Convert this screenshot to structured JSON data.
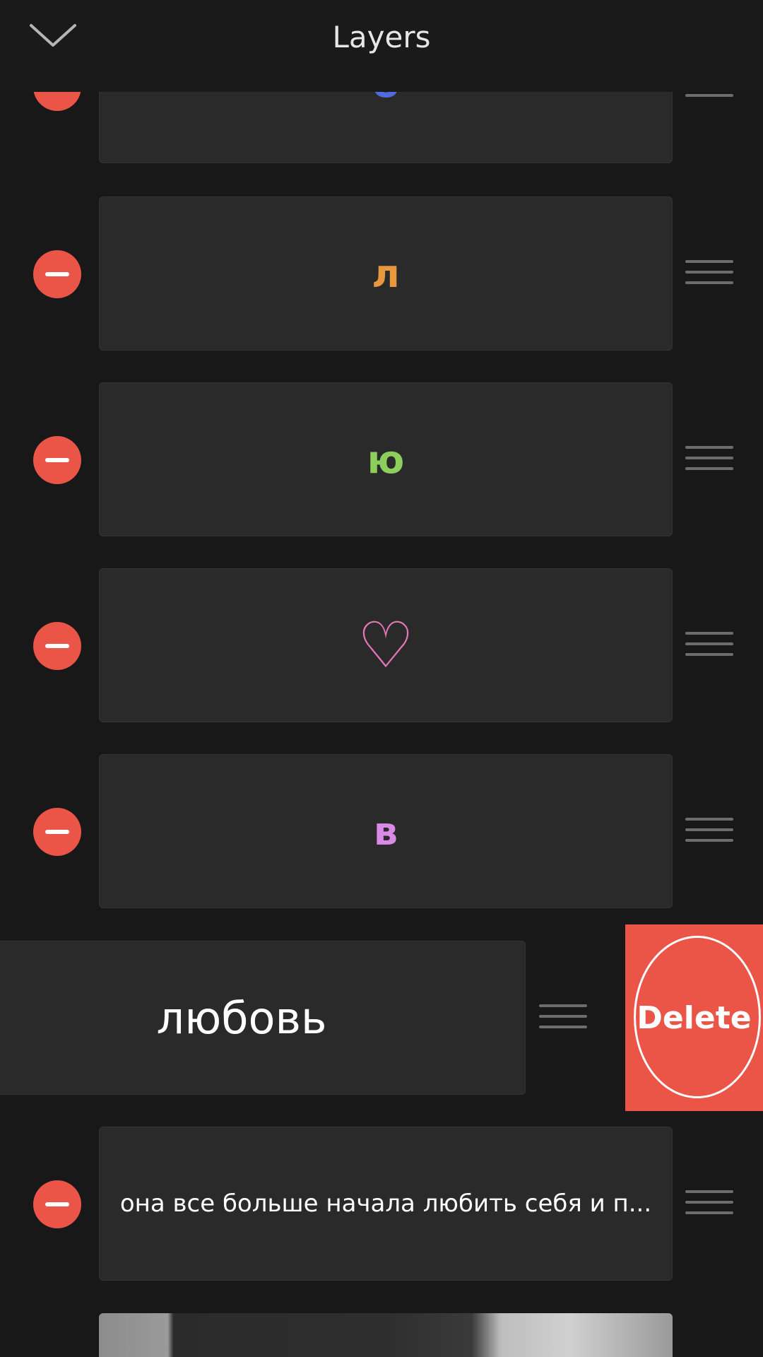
{
  "header": {
    "title": "Layers",
    "back_icon": "chevron-down-icon"
  },
  "layers": [
    {
      "text": "б",
      "color": "#4f6de0"
    },
    {
      "text": "л",
      "color": "#e8973f"
    },
    {
      "text": "ю",
      "color": "#8ccf5c"
    },
    {
      "text": "♡",
      "color": "#e377b8"
    },
    {
      "text": "в",
      "color": "#d98ae6"
    },
    {
      "text": "любовь",
      "color": "#ffffff"
    },
    {
      "text": "она все больше начала любить себя и п...",
      "color": "#ffffff"
    }
  ],
  "swiped_layer": {
    "delete_label": "Delete"
  },
  "colors": {
    "accent_red": "#ea5548",
    "background": "#181818",
    "card": "#2a2a2a"
  }
}
